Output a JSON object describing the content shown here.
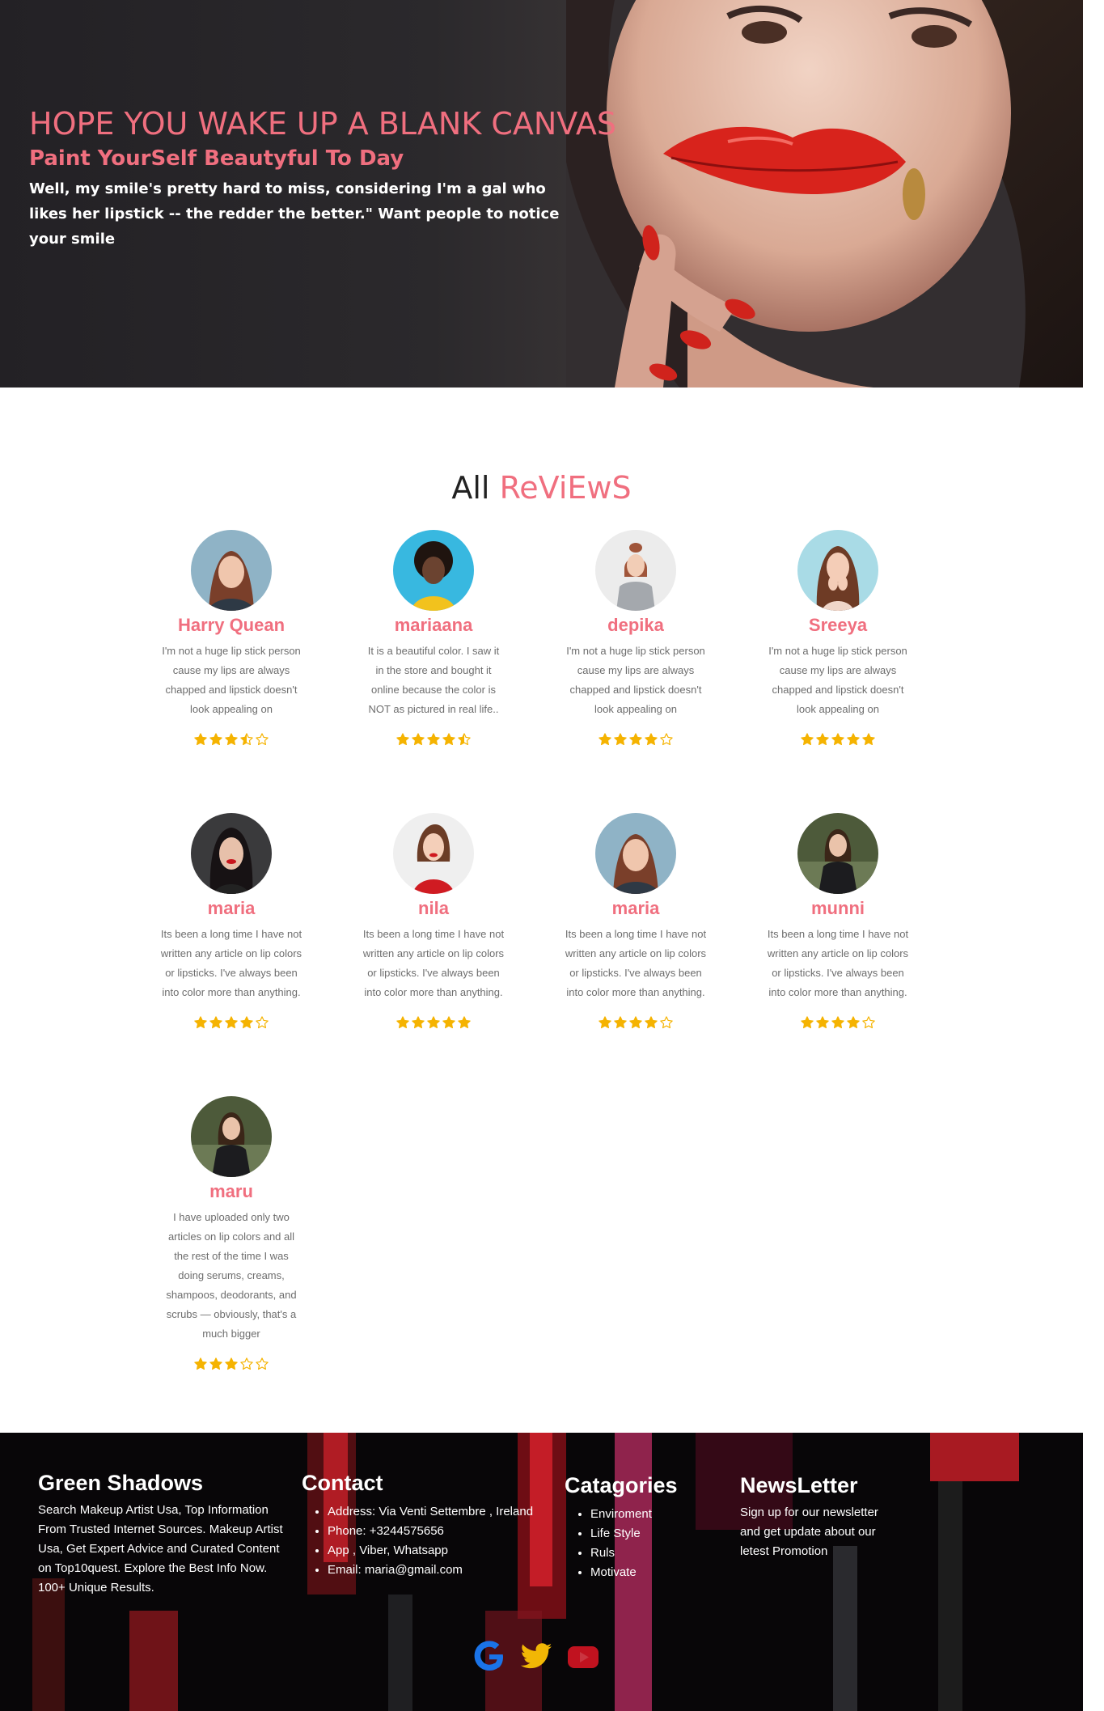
{
  "hero": {
    "title": "HOPE YOU WAKE UP A BLANK CANVAS",
    "subtitle": "Paint YourSelf Beautyful To Day",
    "body": "Well, my smile's pretty hard to miss, considering I'm a gal who likes her lipstick -- the redder the better.\" Want people to notice your smile"
  },
  "reviews": {
    "title_plain": "All",
    "title_accent": "ReViEwS",
    "items": [
      {
        "name": "Harry Quean",
        "text": "I'm not a huge lip stick person cause my lips are always chapped and lipstick doesn't look appealing on",
        "rating": 3.5
      },
      {
        "name": "mariaana",
        "text": "It is a beautiful color. I saw it in the store and bought it online because the color is NOT as pictured in real life..",
        "rating": 4.5
      },
      {
        "name": "depika",
        "text": "I'm not a huge lip stick person cause my lips are always chapped and lipstick doesn't look appealing on",
        "rating": 4
      },
      {
        "name": "Sreeya",
        "text": "I'm not a huge lip stick person cause my lips are always chapped and lipstick doesn't look appealing on",
        "rating": 5
      },
      {
        "name": "maria",
        "text": "Its been a long time I have not written any article on lip colors or lipsticks. I've always been into color more than anything.",
        "rating": 4
      },
      {
        "name": "nila",
        "text": "Its been a long time I have not written any article on lip colors or lipsticks. I've always been into color more than anything.",
        "rating": 5
      },
      {
        "name": "maria",
        "text": "Its been a long time I have not written any article on lip colors or lipsticks. I've always been into color more than anything.",
        "rating": 4
      },
      {
        "name": "munni",
        "text": "Its been a long time I have not written any article on lip colors or lipsticks. I've always been into color more than anything.",
        "rating": 4
      },
      {
        "name": "maru",
        "text": "I have uploaded only two articles on lip colors and all the rest of the time I was doing serums, creams, shampoos, deodorants, and scrubs — obviously, that's a much bigger",
        "rating": 3
      }
    ]
  },
  "footer": {
    "brand": {
      "heading": "Green Shadows",
      "text": "Search Makeup Artist Usa, Top Information From Trusted Internet Sources. Makeup Artist Usa, Get Expert Advice and Curated Content on Top10quest. Explore the Best Info Now. 100+ Unique Results."
    },
    "contact": {
      "heading": "Contact",
      "items": [
        "Address: Via Venti Settembre , Ireland",
        "Phone: +3244575656",
        "App , Viber, Whatsapp",
        "Email: maria@gmail.com"
      ]
    },
    "categories": {
      "heading": "Catagories",
      "items": [
        "Enviroment",
        "Life Style",
        "Ruls",
        "Motivate"
      ]
    },
    "newsletter": {
      "heading": "NewsLetter",
      "text": "Sign up for our newsletter and get update about our letest Promotion"
    },
    "socials": [
      "google-icon",
      "twitter-icon",
      "youtube-icon"
    ]
  },
  "colors": {
    "accent": "#f06f7f",
    "star": "#f5b301",
    "footer_bg": "#080608"
  }
}
